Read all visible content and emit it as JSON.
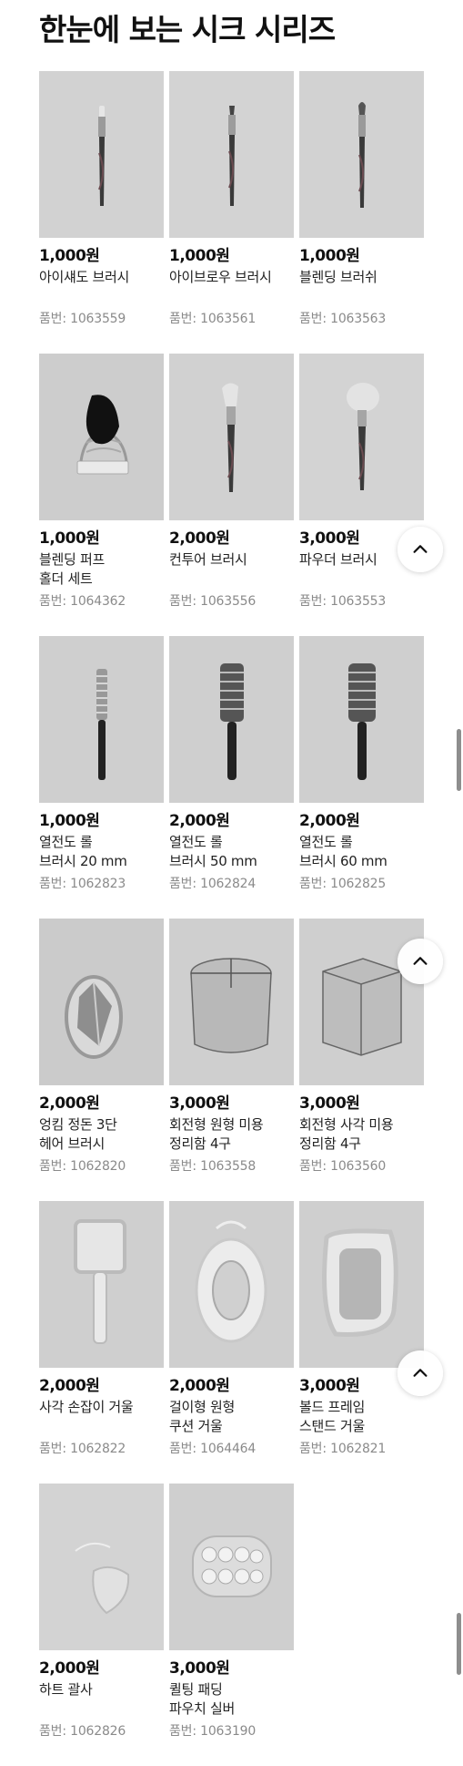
{
  "page": {
    "title": "한눈에 보는 시크 시리즈"
  },
  "products": [
    {
      "price": "1,000원",
      "name": "아이섀도 브러시",
      "code": "품번: 1063559",
      "image": "eyeshadow-brush"
    },
    {
      "price": "1,000원",
      "name": "아이브로우 브러시",
      "code": "품번: 1063561",
      "image": "eyebrow-brush"
    },
    {
      "price": "1,000원",
      "name": "블렌딩 브러쉬",
      "code": "품번: 1063563",
      "image": "blending-brush"
    },
    {
      "price": "1,000원",
      "name": "블렌딩 퍼프\n홀더 세트",
      "code": "품번: 1064362",
      "image": "puff-holder"
    },
    {
      "price": "2,000원",
      "name": "컨투어 브러시",
      "code": "품번: 1063556",
      "image": "contour-brush"
    },
    {
      "price": "3,000원",
      "name": "파우더 브러시",
      "code": "품번: 1063553",
      "image": "powder-brush"
    },
    {
      "price": "1,000원",
      "name": "열전도 롤\n브러시 20 mm",
      "code": "품번: 1062823",
      "image": "roll-brush-20"
    },
    {
      "price": "2,000원",
      "name": "열전도 롤\n브러시 50 mm",
      "code": "품번: 1062824",
      "image": "roll-brush-50"
    },
    {
      "price": "2,000원",
      "name": "열전도 롤\n브러시 60 mm",
      "code": "품번: 1062825",
      "image": "roll-brush-60"
    },
    {
      "price": "2,000원",
      "name": "엉킴 정돈 3단\n헤어 브러시",
      "code": "품번: 1062820",
      "image": "detangle-brush"
    },
    {
      "price": "3,000원",
      "name": "회전형 원형 미용\n정리함 4구",
      "code": "품번: 1063558",
      "image": "round-organizer"
    },
    {
      "price": "3,000원",
      "name": "회전형 사각 미용\n정리함 4구",
      "code": "품번: 1063560",
      "image": "square-organizer"
    },
    {
      "price": "2,000원",
      "name": "사각 손잡이 거울",
      "code": "품번: 1062822",
      "image": "hand-mirror"
    },
    {
      "price": "2,000원",
      "name": "걸이형 원형\n쿠션 거울",
      "code": "품번: 1064464",
      "image": "cushion-mirror"
    },
    {
      "price": "3,000원",
      "name": "볼드 프레임\n스탠드 거울",
      "code": "품번: 1062821",
      "image": "stand-mirror"
    },
    {
      "price": "2,000원",
      "name": "하트 괄사",
      "code": "품번: 1062826",
      "image": "heart-gua-sha"
    },
    {
      "price": "3,000원",
      "name": "퀼팅 패딩\n파우치 실버",
      "code": "품번: 1063190",
      "image": "quilted-pouch"
    }
  ],
  "controls": {
    "scroll_top_icon": "chevron-up-icon"
  }
}
